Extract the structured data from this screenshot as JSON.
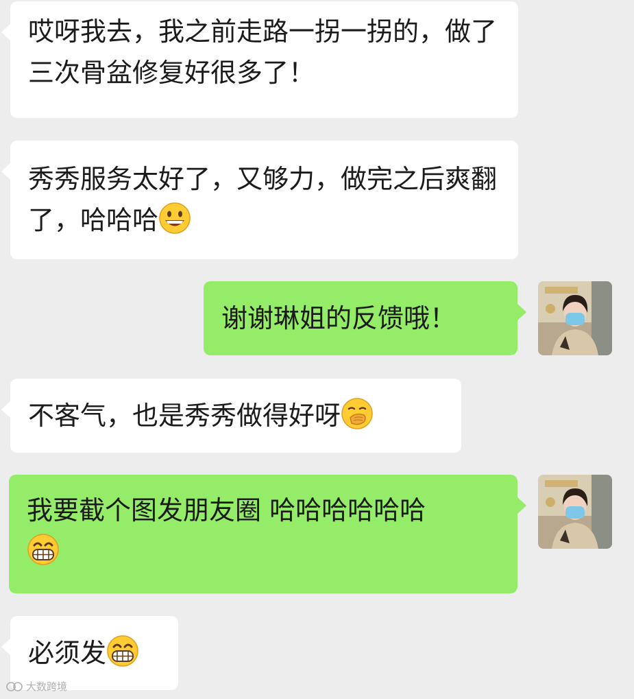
{
  "messages": [
    {
      "side": "left",
      "text": "哎呀我去，我之前走路一拐一拐的，做了三次骨盆修复好很多了！",
      "emoji": ""
    },
    {
      "side": "left",
      "text": "秀秀服务太好了，又够力，做完之后爽翻了，哈哈哈",
      "emoji": "grinning-face-icon"
    },
    {
      "side": "right",
      "text": "谢谢琳姐的反馈哦！",
      "emoji": ""
    },
    {
      "side": "left",
      "text": "不客气，也是秀秀做得好呀",
      "emoji": "face-with-hand-over-mouth-icon"
    },
    {
      "side": "right",
      "text": "我要截个图发朋友圈 哈哈哈哈哈哈",
      "emoji": "grimacing-grin-icon"
    },
    {
      "side": "left",
      "text": "必须发",
      "emoji": "grimacing-grin-icon"
    }
  ],
  "watermark": {
    "text": "大数跨境"
  },
  "colors": {
    "background": "#ededed",
    "left_bubble": "#ffffff",
    "right_bubble": "#95ec69"
  }
}
